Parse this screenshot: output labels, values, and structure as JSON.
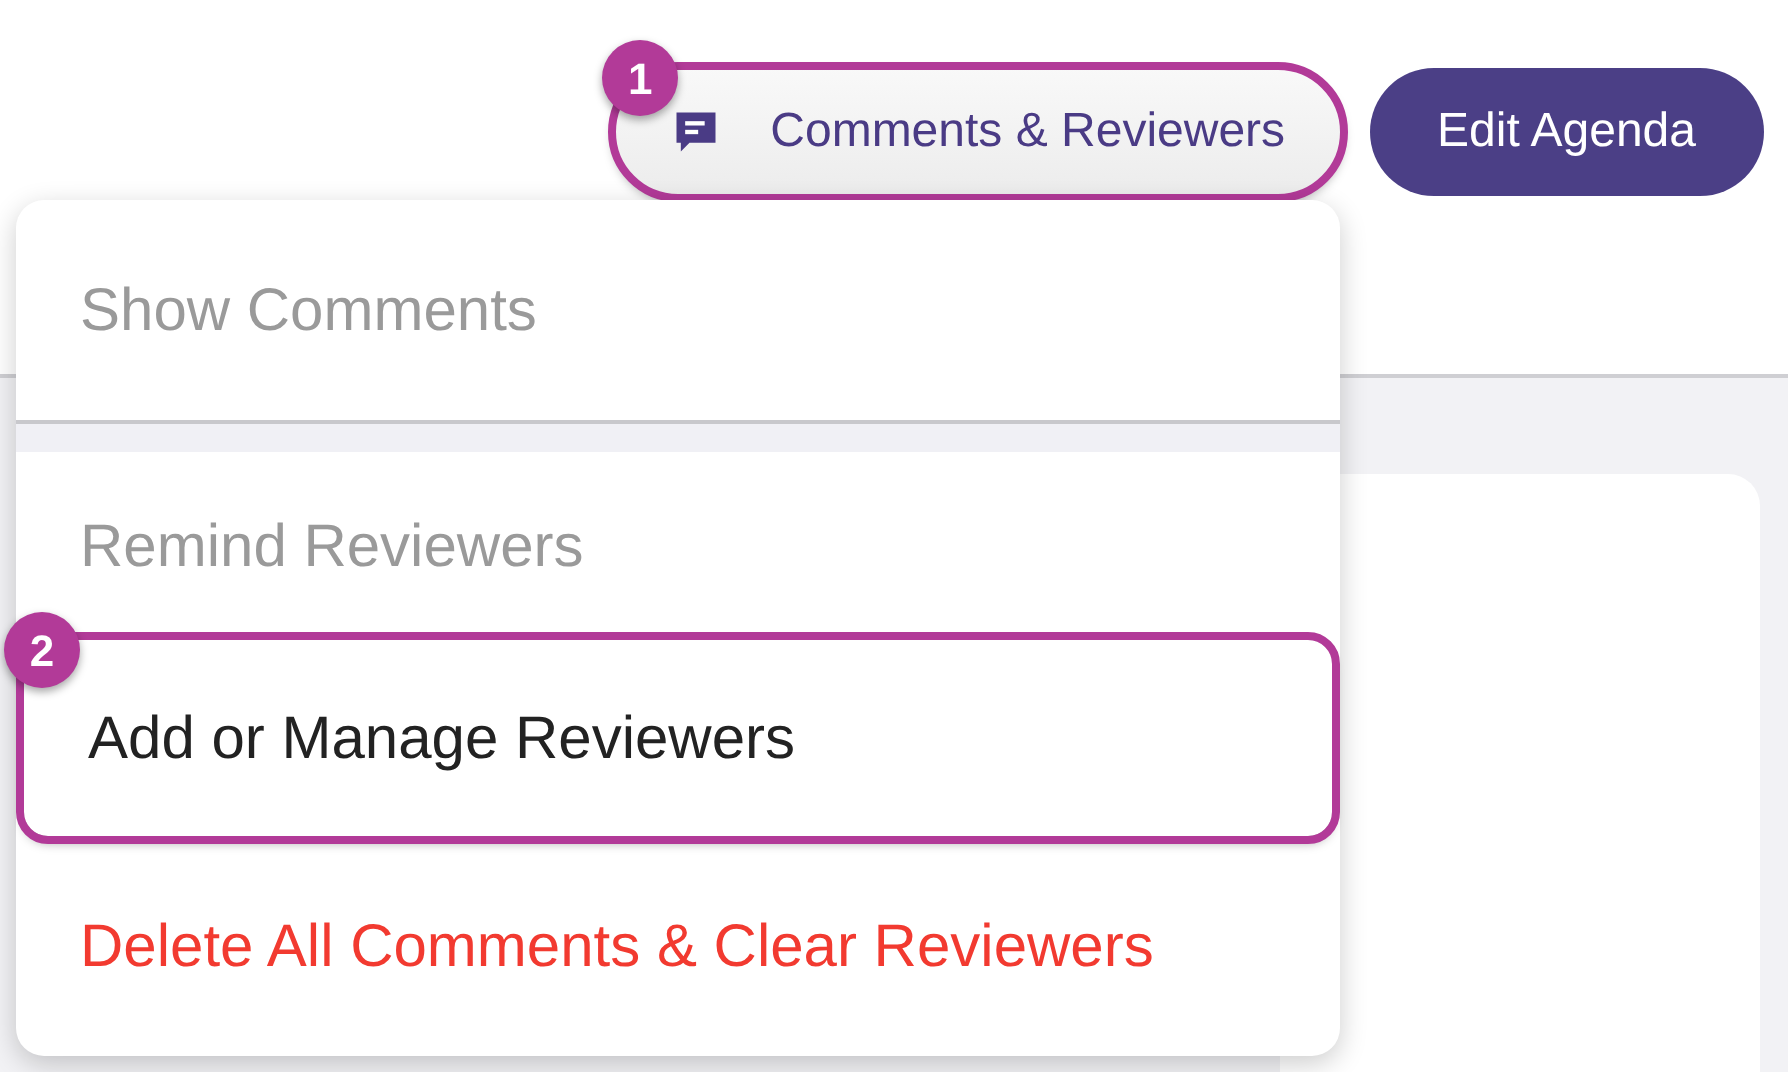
{
  "toolbar": {
    "buttons": [
      {
        "label": "Comments & Reviewers",
        "kind": "secondary",
        "callout": "1"
      },
      {
        "label": "Edit Agenda",
        "kind": "primary"
      }
    ]
  },
  "menu": {
    "sections": [
      [
        {
          "label": "Show Comments",
          "kind": "normal",
          "disabled": true
        }
      ],
      [
        {
          "label": "Remind Reviewers",
          "kind": "normal",
          "disabled": true
        },
        {
          "label": "Add or Manage Reviewers",
          "kind": "normal",
          "disabled": false,
          "callout": "2"
        },
        {
          "label": "Delete All Comments & Clear Reviewers",
          "kind": "danger",
          "disabled": false
        }
      ]
    ]
  }
}
